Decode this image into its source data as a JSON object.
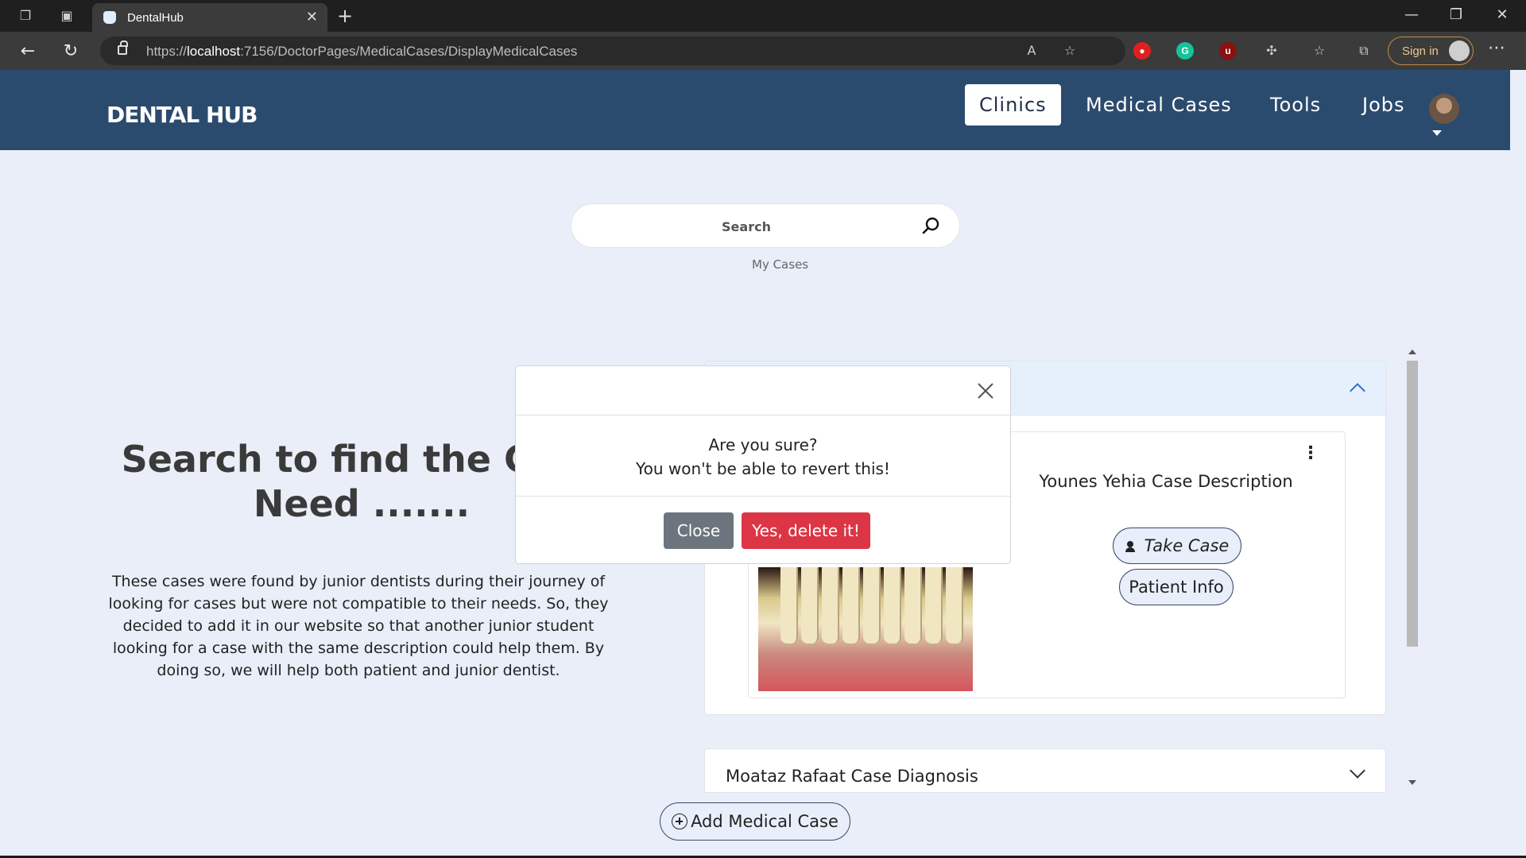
{
  "browser": {
    "tab_title": "DentalHub",
    "url_prefix": "https://",
    "url_host": "localhost",
    "url_path": ":7156/DoctorPages/MedicalCases/DisplayMedicalCases",
    "signin_label": "Sign in"
  },
  "site": {
    "logo": "DENTAL HUB",
    "nav": [
      "Clinics",
      "Medical Cases",
      "Tools",
      "Jobs"
    ]
  },
  "search": {
    "placeholder": "Search",
    "my_cases": "My Cases"
  },
  "hero": {
    "title_line1": "Search to find the Case",
    "title_line2": "Need .......",
    "text": "These cases were found by junior dentists during their journey of looking for cases but were not compatible to their needs. So, they decided to add it in our website so that another junior student looking for a case with the same description could help them. By doing so, we will help both patient and junior dentist."
  },
  "cases": {
    "open_case_description": "Younes Yehia Case Description",
    "take_case_label": "Take Case",
    "patient_info_label": "Patient Info",
    "second_case_title": "Moataz Rafaat Case Diagnosis",
    "add_case_label": "Add Medical Case"
  },
  "modal": {
    "line1": "Are you sure?",
    "line2": "You won't be able to revert this!",
    "close_label": "Close",
    "confirm_label": "Yes, delete it!"
  },
  "colors": {
    "header": "#2b4b6e",
    "page_bg": "#e9eef8",
    "danger": "#dc3545",
    "secondary": "#6c757d"
  }
}
